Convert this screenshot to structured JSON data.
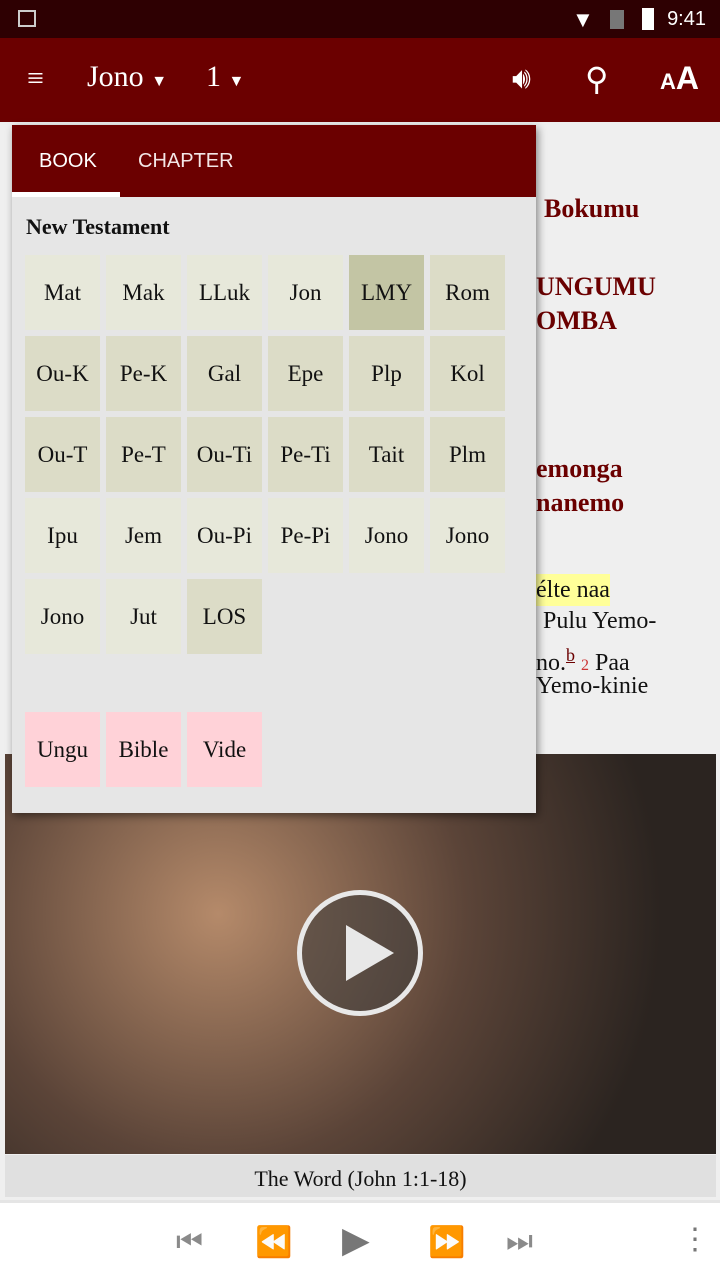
{
  "status": {
    "time": "9:41",
    "icons": [
      "image-icon",
      "wifi-icon",
      "no-sim-icon",
      "battery-icon"
    ]
  },
  "appbar": {
    "book": "Jono",
    "chapter": "1",
    "icons": [
      "menu-icon",
      "speaker-icon",
      "search-icon",
      "text-size-icon"
    ],
    "bg": "#6b0000"
  },
  "content": {
    "headings": [
      "Bokumu",
      "UNGUMU",
      "OMBA",
      "emonga",
      "nanemo"
    ],
    "lines": [
      "élte naa",
      "Pulu Yemo-",
      "no.",
      "Paa",
      "Yemo-kinie"
    ],
    "footnote": "b",
    "verse": "2"
  },
  "popup": {
    "tabs": [
      "BOOK",
      "CHAPTER"
    ],
    "section": "New Testament",
    "books": [
      "Mat",
      "Mak",
      "LLuk",
      "Jon",
      "LMY",
      "Rom",
      "Ou-K",
      "Pe-K",
      "Gal",
      "Epe",
      "Plp",
      "Kol",
      "Ou-T",
      "Pe-T",
      "Ou-Ti",
      "Pe-Ti",
      "Tait",
      "Plm",
      "Ipu",
      "Jem",
      "Ou-Pi",
      "Pe-Pi",
      "Jono",
      "Jono",
      "Jono",
      "Jut",
      "LOS"
    ],
    "extras": [
      "Ungu",
      "Bible",
      "Vide"
    ],
    "selected": "LMY"
  },
  "video": {
    "caption": "The Word (John 1:1-18)"
  },
  "player": {
    "icons": [
      "skip-previous-icon",
      "rewind-icon",
      "play-icon",
      "fast-forward-icon",
      "skip-next-icon",
      "more-icon"
    ]
  }
}
